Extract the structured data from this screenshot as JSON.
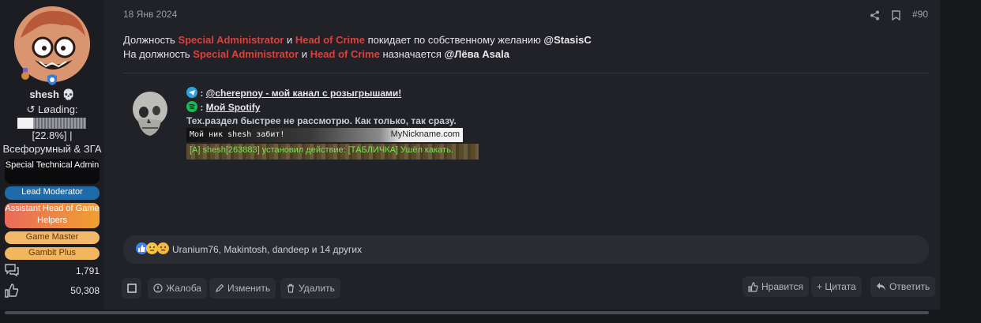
{
  "user": {
    "name": "shesh 💀",
    "status_line": "↺ Løading:",
    "loading_progress": 0.228,
    "loading_percent": "[22.8%] |",
    "title": "Всефорумный & ЗГА",
    "roles": [
      {
        "label": "Special Technical Admin",
        "color": "#0b0b0d"
      },
      {
        "label": "Lead Moderator",
        "color": "#1f6aa8"
      },
      {
        "label": "Assistant Head of Game Helpers",
        "color": "#f0a030"
      },
      {
        "label": "Game Master",
        "color": "#f4b86a"
      },
      {
        "label": "Gambit Plus",
        "color": "#f2b65e"
      }
    ],
    "stats": {
      "messages": "1,791",
      "reactions": "50,308"
    }
  },
  "post": {
    "date": "18 Янв 2024",
    "number": "#90",
    "line1": {
      "prefix": "Должность ",
      "role1": "Special Administrator",
      "and": " и ",
      "role2": "Head of Crime",
      "suffix": " покидает по собственному желанию ",
      "mention": "@StasisC"
    },
    "line2": {
      "prefix": "На должность ",
      "role1": "Special Administrator",
      "and": " и ",
      "role2": "Head of Crime",
      "suffix": " назначается ",
      "mention": "@Лёва Asala"
    }
  },
  "signature": {
    "telegram_sep": " : ",
    "telegram_link": "@cherepnoy - мой канал с розыгрышами!",
    "spotify_sep": " : ",
    "spotify_link": "Мой Spotify",
    "note": "Тех.раздел быстрее не рассмотрю. Как только, так сразу.",
    "nick_banner_left": "Мой ник shesh забит!",
    "nick_banner_right": "MyNickname.com",
    "game_log": "[A] shesh[263883] установил действие: [ТАБЛИЧКА] Ушёл какать."
  },
  "reactions": {
    "icons": [
      "like-reaction",
      "thinking-reaction",
      "meh-reaction"
    ],
    "text": "Uranium76, Makintosh, dandeep и 14 других"
  },
  "actions": {
    "report": "Жалоба",
    "edit": "Изменить",
    "delete": "Удалить",
    "like": "Нравится",
    "quote": "+ Цитата",
    "reply": "Ответить"
  },
  "colors": {
    "accent_red": "#d9423c",
    "background": "#212228",
    "panel": "#2b2c33"
  }
}
